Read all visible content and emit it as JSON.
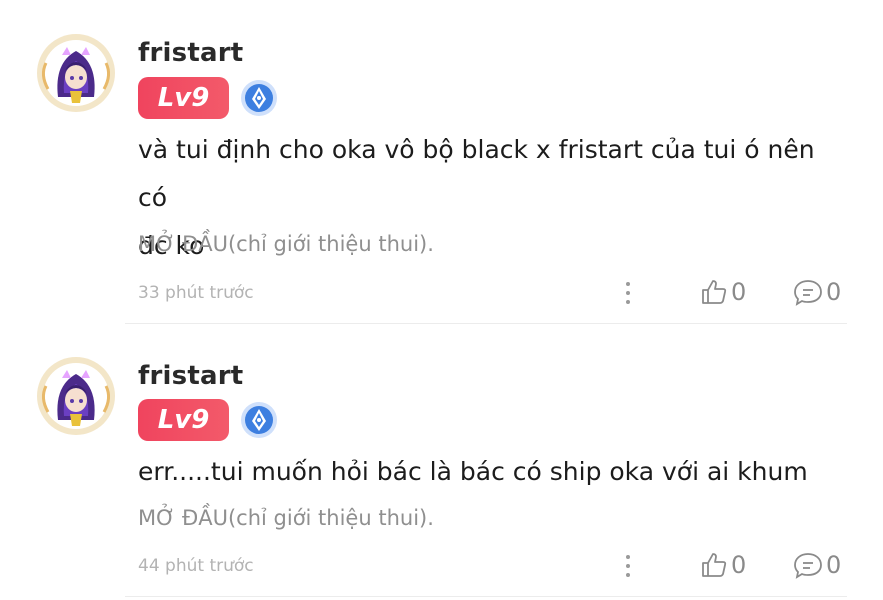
{
  "comments": [
    {
      "username": "fristart",
      "level": "Lv9",
      "body_lines": [
        "và tui định cho oka vô bộ black x fristart của tui ó nên có",
        "đc ko"
      ],
      "tag": "MỞ ĐẦU(chỉ giới thiệu thui).",
      "time": "33 phút trước",
      "likes": "0",
      "replies": "0"
    },
    {
      "username": "fristart",
      "level": "Lv9",
      "body_lines": [
        "err.....tui muốn hỏi bác là bác có ship oka với ai khum"
      ],
      "tag": "MỞ ĐẦU(chỉ giới thiệu thui).",
      "time": "44 phút trước",
      "likes": "0",
      "replies": "0"
    }
  ],
  "colors": {
    "level_badge": "#f0445e",
    "verify_badge": "#3d7fe0",
    "secondary_text": "#8f8f8f",
    "divider": "#ececec"
  },
  "icons": {
    "more": "more-vertical-icon",
    "like": "thumbs-up-icon",
    "reply": "comment-bubble-icon",
    "verify": "verified-pen-badge-icon"
  }
}
